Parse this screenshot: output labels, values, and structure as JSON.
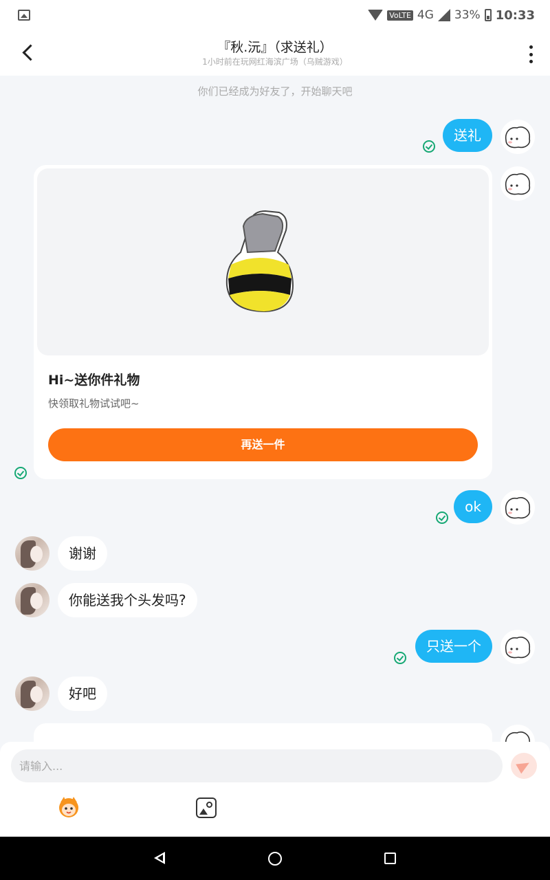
{
  "status_bar": {
    "network": "VoLTE",
    "network_type": "4G",
    "battery": "33%",
    "time": "10:33",
    "icons": [
      "image-notification-icon",
      "wifi-icon",
      "signal-icon",
      "battery-icon"
    ]
  },
  "header": {
    "title": "『秋.沅』（求送礼）",
    "subtitle": "1小时前在玩网红海滨广场（乌贼游戏）",
    "icons": [
      "back-arrow-icon",
      "more-vertical-icon"
    ]
  },
  "system_message": "你们已经成为好友了，开始聊天吧",
  "messages": [
    {
      "from": "me",
      "type": "text",
      "text": "送礼",
      "status": "sent"
    },
    {
      "from": "me",
      "type": "gift",
      "status": "sent"
    },
    {
      "from": "me",
      "type": "text",
      "text": "ok",
      "status": "sent"
    },
    {
      "from": "her",
      "type": "text",
      "text": "谢谢"
    },
    {
      "from": "her",
      "type": "text",
      "text": "你能送我个头发吗?"
    },
    {
      "from": "me",
      "type": "text",
      "text": "只送一个",
      "status": "sent"
    },
    {
      "from": "her",
      "type": "text",
      "text": "好吧"
    }
  ],
  "gift_card": {
    "title": "Hi~送你件礼物",
    "description": "快领取礼物试试吧~",
    "button_label": "再送一件",
    "image": "bee-grenade-gift"
  },
  "input_bar": {
    "placeholder": "请输入...",
    "value": "",
    "icons": [
      "send-icon",
      "emoji-monkey-icon",
      "image-picker-icon"
    ]
  },
  "colors": {
    "my_bubble": "#1fb6f5",
    "gift_button": "#fd7213",
    "sent_check": "#16a874",
    "background": "#f4f6f9"
  },
  "nav_bar": {
    "icons": [
      "nav-back-icon",
      "nav-home-icon",
      "nav-recent-icon"
    ]
  }
}
